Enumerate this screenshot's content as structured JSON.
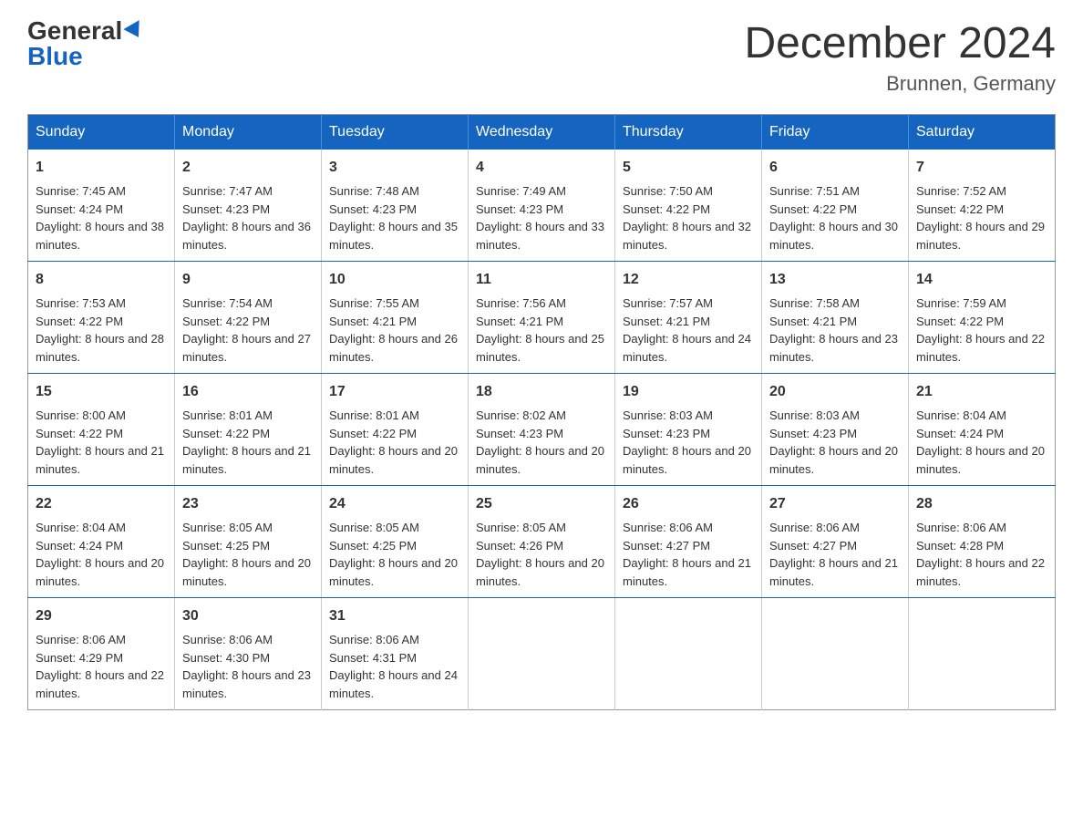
{
  "logo": {
    "general": "General",
    "blue": "Blue"
  },
  "title": "December 2024",
  "location": "Brunnen, Germany",
  "days_header": [
    "Sunday",
    "Monday",
    "Tuesday",
    "Wednesday",
    "Thursday",
    "Friday",
    "Saturday"
  ],
  "weeks": [
    [
      {
        "day": "1",
        "sunrise": "7:45 AM",
        "sunset": "4:24 PM",
        "daylight": "8 hours and 38 minutes."
      },
      {
        "day": "2",
        "sunrise": "7:47 AM",
        "sunset": "4:23 PM",
        "daylight": "8 hours and 36 minutes."
      },
      {
        "day": "3",
        "sunrise": "7:48 AM",
        "sunset": "4:23 PM",
        "daylight": "8 hours and 35 minutes."
      },
      {
        "day": "4",
        "sunrise": "7:49 AM",
        "sunset": "4:23 PM",
        "daylight": "8 hours and 33 minutes."
      },
      {
        "day": "5",
        "sunrise": "7:50 AM",
        "sunset": "4:22 PM",
        "daylight": "8 hours and 32 minutes."
      },
      {
        "day": "6",
        "sunrise": "7:51 AM",
        "sunset": "4:22 PM",
        "daylight": "8 hours and 30 minutes."
      },
      {
        "day": "7",
        "sunrise": "7:52 AM",
        "sunset": "4:22 PM",
        "daylight": "8 hours and 29 minutes."
      }
    ],
    [
      {
        "day": "8",
        "sunrise": "7:53 AM",
        "sunset": "4:22 PM",
        "daylight": "8 hours and 28 minutes."
      },
      {
        "day": "9",
        "sunrise": "7:54 AM",
        "sunset": "4:22 PM",
        "daylight": "8 hours and 27 minutes."
      },
      {
        "day": "10",
        "sunrise": "7:55 AM",
        "sunset": "4:21 PM",
        "daylight": "8 hours and 26 minutes."
      },
      {
        "day": "11",
        "sunrise": "7:56 AM",
        "sunset": "4:21 PM",
        "daylight": "8 hours and 25 minutes."
      },
      {
        "day": "12",
        "sunrise": "7:57 AM",
        "sunset": "4:21 PM",
        "daylight": "8 hours and 24 minutes."
      },
      {
        "day": "13",
        "sunrise": "7:58 AM",
        "sunset": "4:21 PM",
        "daylight": "8 hours and 23 minutes."
      },
      {
        "day": "14",
        "sunrise": "7:59 AM",
        "sunset": "4:22 PM",
        "daylight": "8 hours and 22 minutes."
      }
    ],
    [
      {
        "day": "15",
        "sunrise": "8:00 AM",
        "sunset": "4:22 PM",
        "daylight": "8 hours and 21 minutes."
      },
      {
        "day": "16",
        "sunrise": "8:01 AM",
        "sunset": "4:22 PM",
        "daylight": "8 hours and 21 minutes."
      },
      {
        "day": "17",
        "sunrise": "8:01 AM",
        "sunset": "4:22 PM",
        "daylight": "8 hours and 20 minutes."
      },
      {
        "day": "18",
        "sunrise": "8:02 AM",
        "sunset": "4:23 PM",
        "daylight": "8 hours and 20 minutes."
      },
      {
        "day": "19",
        "sunrise": "8:03 AM",
        "sunset": "4:23 PM",
        "daylight": "8 hours and 20 minutes."
      },
      {
        "day": "20",
        "sunrise": "8:03 AM",
        "sunset": "4:23 PM",
        "daylight": "8 hours and 20 minutes."
      },
      {
        "day": "21",
        "sunrise": "8:04 AM",
        "sunset": "4:24 PM",
        "daylight": "8 hours and 20 minutes."
      }
    ],
    [
      {
        "day": "22",
        "sunrise": "8:04 AM",
        "sunset": "4:24 PM",
        "daylight": "8 hours and 20 minutes."
      },
      {
        "day": "23",
        "sunrise": "8:05 AM",
        "sunset": "4:25 PM",
        "daylight": "8 hours and 20 minutes."
      },
      {
        "day": "24",
        "sunrise": "8:05 AM",
        "sunset": "4:25 PM",
        "daylight": "8 hours and 20 minutes."
      },
      {
        "day": "25",
        "sunrise": "8:05 AM",
        "sunset": "4:26 PM",
        "daylight": "8 hours and 20 minutes."
      },
      {
        "day": "26",
        "sunrise": "8:06 AM",
        "sunset": "4:27 PM",
        "daylight": "8 hours and 21 minutes."
      },
      {
        "day": "27",
        "sunrise": "8:06 AM",
        "sunset": "4:27 PM",
        "daylight": "8 hours and 21 minutes."
      },
      {
        "day": "28",
        "sunrise": "8:06 AM",
        "sunset": "4:28 PM",
        "daylight": "8 hours and 22 minutes."
      }
    ],
    [
      {
        "day": "29",
        "sunrise": "8:06 AM",
        "sunset": "4:29 PM",
        "daylight": "8 hours and 22 minutes."
      },
      {
        "day": "30",
        "sunrise": "8:06 AM",
        "sunset": "4:30 PM",
        "daylight": "8 hours and 23 minutes."
      },
      {
        "day": "31",
        "sunrise": "8:06 AM",
        "sunset": "4:31 PM",
        "daylight": "8 hours and 24 minutes."
      },
      null,
      null,
      null,
      null
    ]
  ]
}
